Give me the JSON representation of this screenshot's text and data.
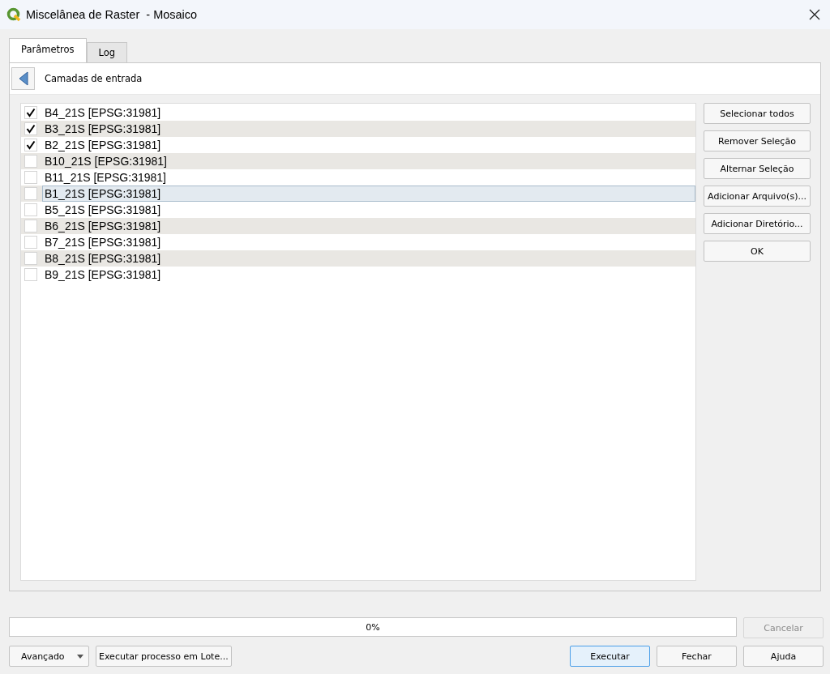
{
  "window": {
    "title": "Miscelânea de Raster  - Mosaico"
  },
  "tabs": [
    {
      "label": "Parâmetros",
      "selected": true
    },
    {
      "label": "Log",
      "selected": false
    }
  ],
  "header": {
    "title": "Camadas de entrada"
  },
  "layers": [
    {
      "label": "B4_21S [EPSG:31981]",
      "checked": true,
      "selected": false
    },
    {
      "label": "B3_21S [EPSG:31981]",
      "checked": true,
      "selected": false
    },
    {
      "label": "B2_21S [EPSG:31981]",
      "checked": true,
      "selected": false
    },
    {
      "label": "B10_21S [EPSG:31981]",
      "checked": false,
      "selected": false
    },
    {
      "label": "B11_21S [EPSG:31981]",
      "checked": false,
      "selected": false
    },
    {
      "label": "B1_21S [EPSG:31981]",
      "checked": false,
      "selected": true
    },
    {
      "label": "B5_21S [EPSG:31981]",
      "checked": false,
      "selected": false
    },
    {
      "label": "B6_21S [EPSG:31981]",
      "checked": false,
      "selected": false
    },
    {
      "label": "B7_21S [EPSG:31981]",
      "checked": false,
      "selected": false
    },
    {
      "label": "B8_21S [EPSG:31981]",
      "checked": false,
      "selected": false
    },
    {
      "label": "B9_21S [EPSG:31981]",
      "checked": false,
      "selected": false
    }
  ],
  "side_buttons": [
    "Selecionar todos",
    "Remover Seleção",
    "Alternar Seleção",
    "Adicionar Arquivo(s)...",
    "Adicionar Diretório...",
    "OK"
  ],
  "progress": {
    "level": 0,
    "reading": "0%"
  },
  "cancel_button": {
    "label": "Cancelar",
    "disabled": true
  },
  "advanced_button": {
    "label": "Avançado"
  },
  "batch_button": {
    "label": "Executar processo em Lote..."
  },
  "footer_buttons": [
    {
      "label": "Executar",
      "kind": "default"
    },
    {
      "label": "Fechar",
      "kind": "normal"
    },
    {
      "label": "Ajuda",
      "kind": "normal"
    }
  ]
}
